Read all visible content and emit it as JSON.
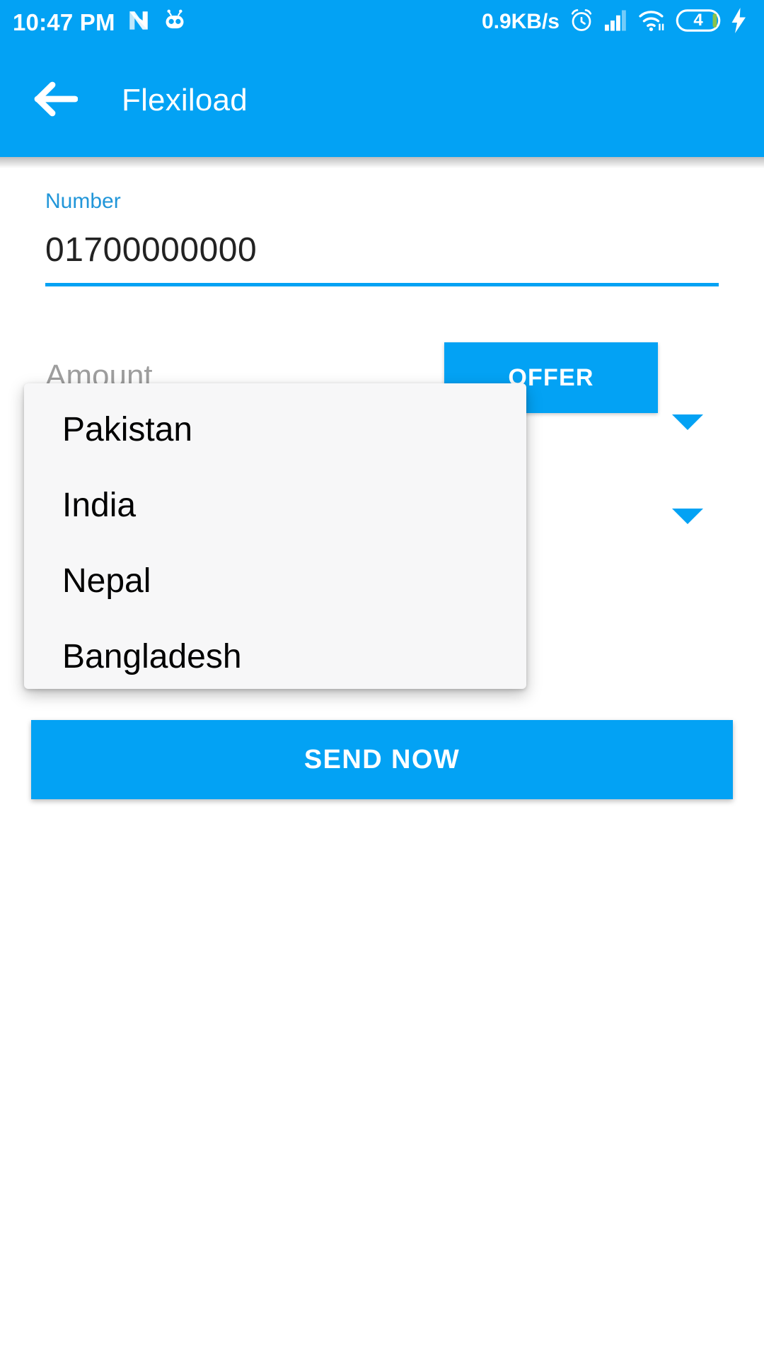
{
  "status_bar": {
    "time": "10:47 PM",
    "network_speed": "0.9KB/s",
    "battery_level": "4",
    "icons": {
      "nougat": "n-logo-icon",
      "bot": "robot-icon",
      "alarm": "alarm-clock-icon",
      "signal": "cellular-signal-icon",
      "wifi": "wifi-icon",
      "battery": "battery-icon",
      "charging": "charging-bolt-icon"
    },
    "background_color": "#03A2F4"
  },
  "app_bar": {
    "title": "Flexiload",
    "back_icon": "back-arrow-icon",
    "background_color": "#03A2F4"
  },
  "form": {
    "number_field": {
      "label": "Number",
      "value": "01700000000",
      "label_color": "#2196D9",
      "underline_color": "#03A2F4"
    },
    "amount_field": {
      "placeholder": "Amount",
      "value": "",
      "underline_color": "#9b9b9b"
    },
    "offer_button": {
      "label": "OFFER",
      "background_color": "#03A2F4"
    },
    "send_button": {
      "label": "SEND NOW",
      "background_color": "#03A2F4"
    }
  },
  "dropdown": {
    "open": true,
    "background_color": "#f7f7f8",
    "options": [
      {
        "label": "Pakistan"
      },
      {
        "label": "India"
      },
      {
        "label": "Nepal"
      },
      {
        "label": "Bangladesh"
      }
    ],
    "caret_color": "#03A2F4",
    "caret_icon": "chevron-down-icon"
  }
}
